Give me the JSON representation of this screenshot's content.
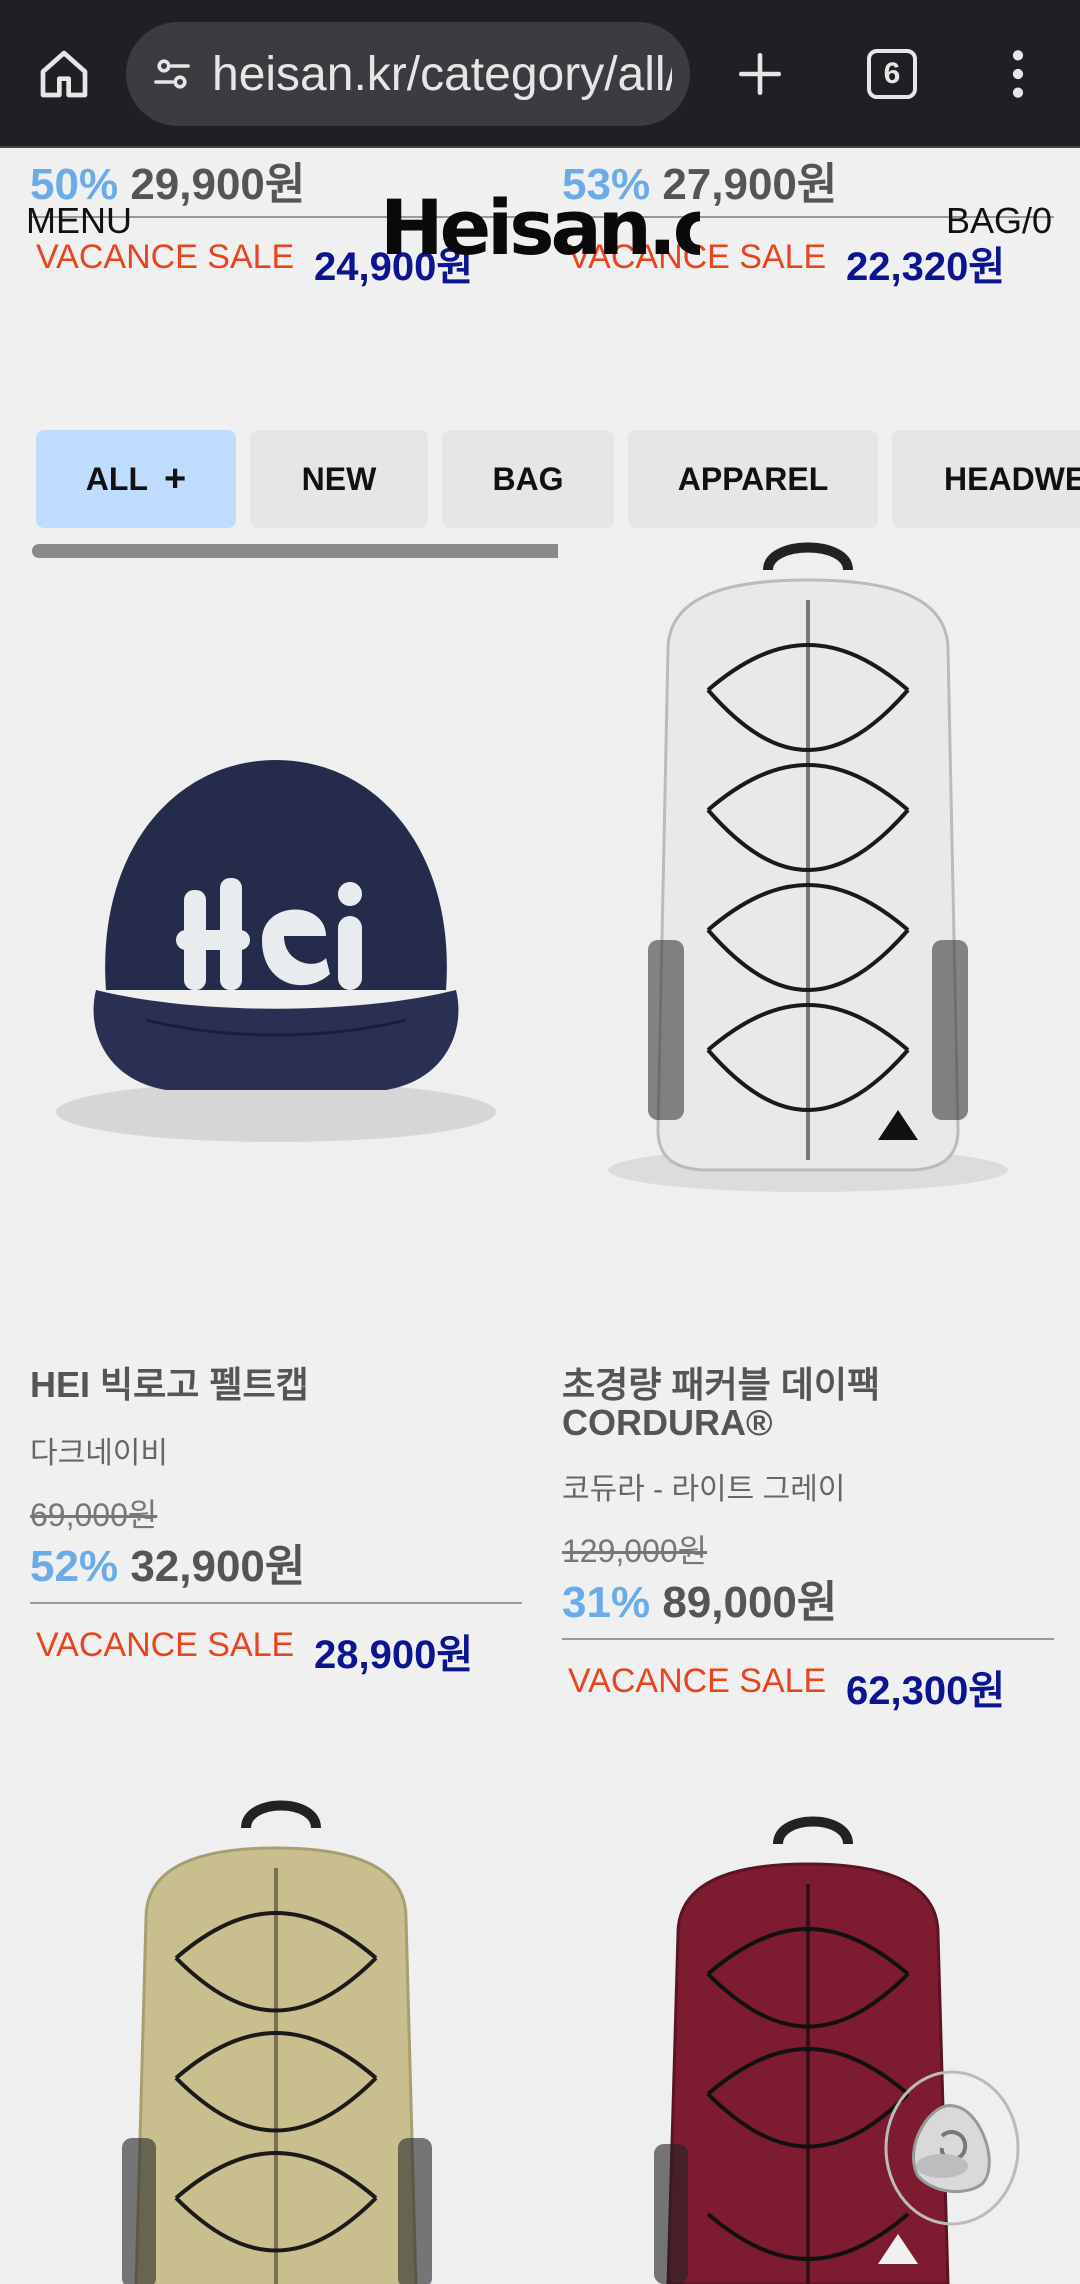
{
  "browser": {
    "url": "heisan.kr/category/all/",
    "tab_count": "6"
  },
  "header": {
    "menu_label": "MENU",
    "bag_label": "BAG/0",
    "logo_text": "Heisan.ca"
  },
  "top_prices": [
    {
      "discount": "50%",
      "price": "29,900원",
      "sale_label": "VACANCE SALE",
      "sale_price": "24,900원"
    },
    {
      "discount": "53%",
      "price": "27,900원",
      "sale_label": "VACANCE SALE",
      "sale_price": "22,320원"
    }
  ],
  "categories": [
    {
      "label": "ALL",
      "suffix": "+",
      "active": true
    },
    {
      "label": "NEW",
      "active": false
    },
    {
      "label": "BAG",
      "active": false
    },
    {
      "label": "APPAREL",
      "active": false
    },
    {
      "label": "HEADWE",
      "active": false
    }
  ],
  "products": [
    {
      "name_line1": "HEI 빅로고 펠트캡",
      "name_line2": "",
      "variant": "다크네이비",
      "original_price": "69,000원",
      "discount": "52%",
      "price": "32,900원",
      "sale_label": "VACANCE SALE",
      "sale_price": "28,900원"
    },
    {
      "name_line1": "초경량 패커블 데이팩",
      "name_line2": "CORDURA®",
      "variant": "코듀라 - 라이트 그레이",
      "original_price": "129,000원",
      "discount": "31%",
      "price": "89,000원",
      "sale_label": "VACANCE SALE",
      "sale_price": "62,300원"
    }
  ],
  "colors": {
    "discount": "#6aabe8",
    "sale_label": "#e8451f",
    "sale_price": "#0c1490",
    "active_tab": "#bfdcff",
    "cap_color": "#252b4a",
    "backpack_white": "#e9e9ec",
    "backpack_olive": "#c9bf8e",
    "backpack_burgundy": "#7d1c30"
  }
}
